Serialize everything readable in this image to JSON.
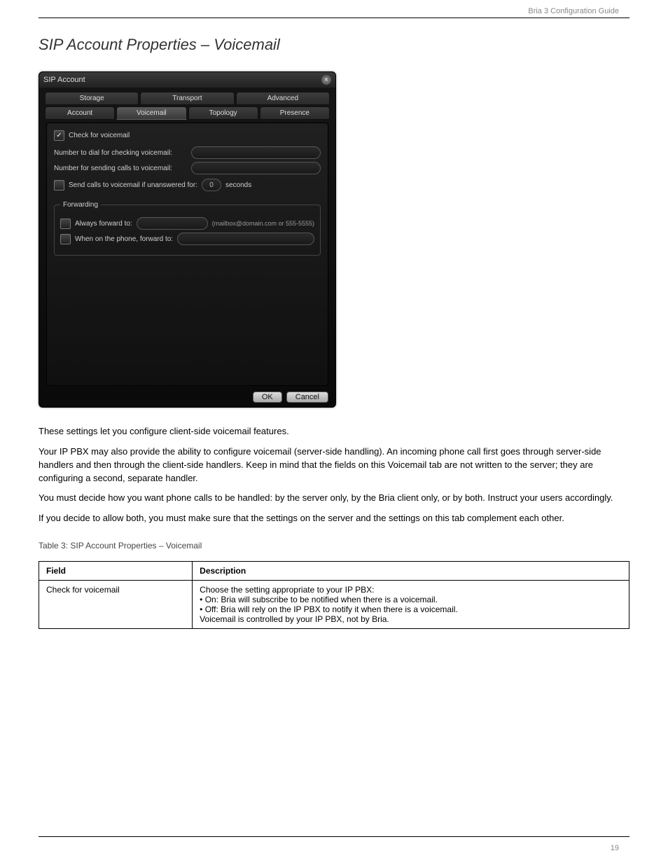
{
  "doc": {
    "header_right": "Bria 3 Configuration Guide",
    "page_number": "19",
    "section_title": "SIP Account Properties – Voicemail",
    "intro_para_1": "These settings let you configure client-side voicemail features.",
    "intro_para_2": "Your IP PBX may also provide the ability to configure voicemail (server-side handling). An incoming phone call first goes through server-side handlers and then through the client-side handlers. Keep in mind that the fields on this Voicemail tab are not written to the server; they are configuring a second, separate handler.",
    "intro_para_3": "You must decide how you want phone calls to be handled: by the server only, by the Bria client only, or by both. Instruct your users accordingly.",
    "intro_para_4": "If you decide to allow both, you must make sure that the settings on the server and the settings on this tab complement each other.",
    "table_caption": "Table 3: SIP Account Properties – Voicemail",
    "table_header_field": "Field",
    "table_header_desc": "Description",
    "row1_field": "Check for voicemail",
    "row1_desc_main": "Choose the setting appropriate to your IP PBX:",
    "row1_bullet_1": "On: Bria will subscribe to be notified when there is a voicemail.",
    "row1_bullet_2": "Off: Bria will rely on the IP PBX to notify it when there is a voicemail.",
    "row1_desc_tail": "Voicemail is controlled by your IP PBX, not by Bria."
  },
  "dialog": {
    "title": "SIP Account",
    "close_icon": "×",
    "tabs_row1": [
      "Storage",
      "Transport",
      "Advanced"
    ],
    "tabs_row2": [
      "Account",
      "Voicemail",
      "Topology",
      "Presence"
    ],
    "active_tab": "Voicemail",
    "chk_check_voicemail_label": "Check for voicemail",
    "chk_check_voicemail_checked": true,
    "label_num_dial": "Number to dial for checking voicemail:",
    "value_num_dial": "",
    "label_num_send": "Number for sending calls to voicemail:",
    "value_num_send": "",
    "chk_unanswered_label": "Send calls to voicemail if unanswered for:",
    "chk_unanswered_checked": false,
    "seconds_value": "0",
    "seconds_suffix": "seconds",
    "forwarding_legend": "Forwarding",
    "chk_always_fwd_label": "Always forward to:",
    "chk_always_fwd_checked": false,
    "always_fwd_value": "",
    "always_fwd_hint": "(mailbox@domain.com or 555-5555)",
    "chk_on_phone_fwd_label": "When on the phone, forward to:",
    "chk_on_phone_fwd_checked": false,
    "on_phone_fwd_value": "",
    "btn_ok": "OK",
    "btn_cancel": "Cancel"
  }
}
